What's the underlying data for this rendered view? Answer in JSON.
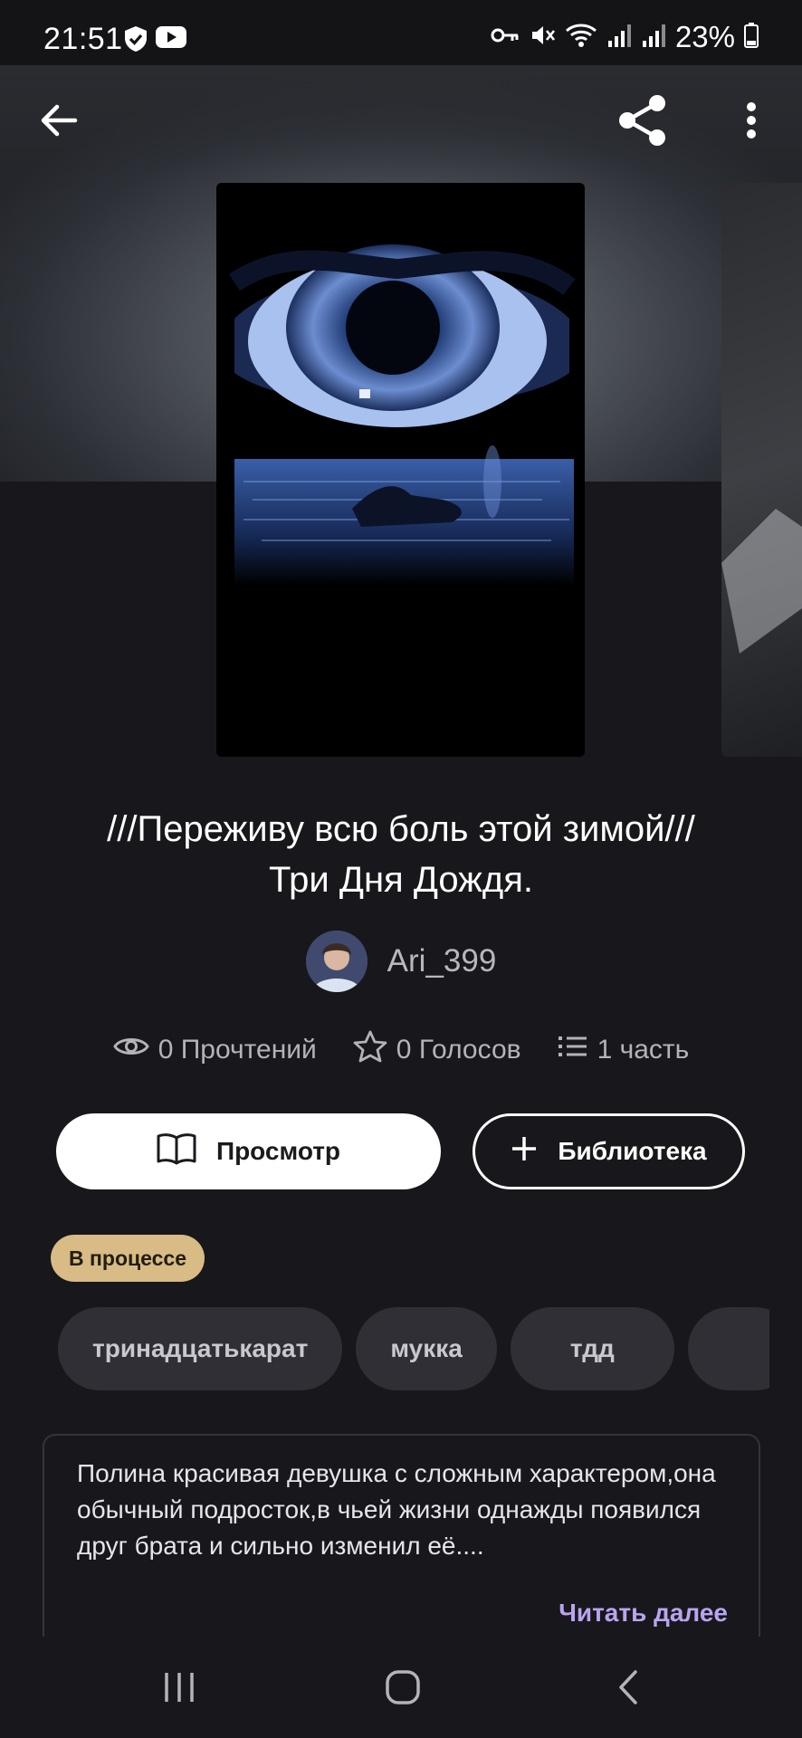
{
  "status_bar": {
    "time": "21:51",
    "battery": "23%"
  },
  "book": {
    "title_line1": "///Переживу всю боль этой зимой///",
    "title_line2": "Три Дня Дождя.",
    "author": "Ari_399",
    "reads": "0 Прочтений",
    "votes": "0 Голосов",
    "parts": "1 часть",
    "status": "В процессе",
    "description": "Полина красивая девушка с сложным характером,она обычный подросток,в чьей жизни однажды появился друг брата и сильно изменил её....",
    "read_more": "Читать далее"
  },
  "actions": {
    "view_label": "Просмотр",
    "library_label": "Библиотека"
  },
  "tags": [
    "тринадцатькарат",
    "мукка",
    "тдд"
  ],
  "icons": {
    "back": "arrow-left-icon",
    "share": "share-icon",
    "more": "more-vertical-icon",
    "eye": "eye-icon",
    "star": "star-icon",
    "list": "list-icon",
    "book": "book-open-icon",
    "plus": "plus-icon"
  },
  "colors": {
    "background": "#18171b",
    "badge": "#d8bb85",
    "tag_bg": "#302f35",
    "link": "#b9a4f0"
  }
}
